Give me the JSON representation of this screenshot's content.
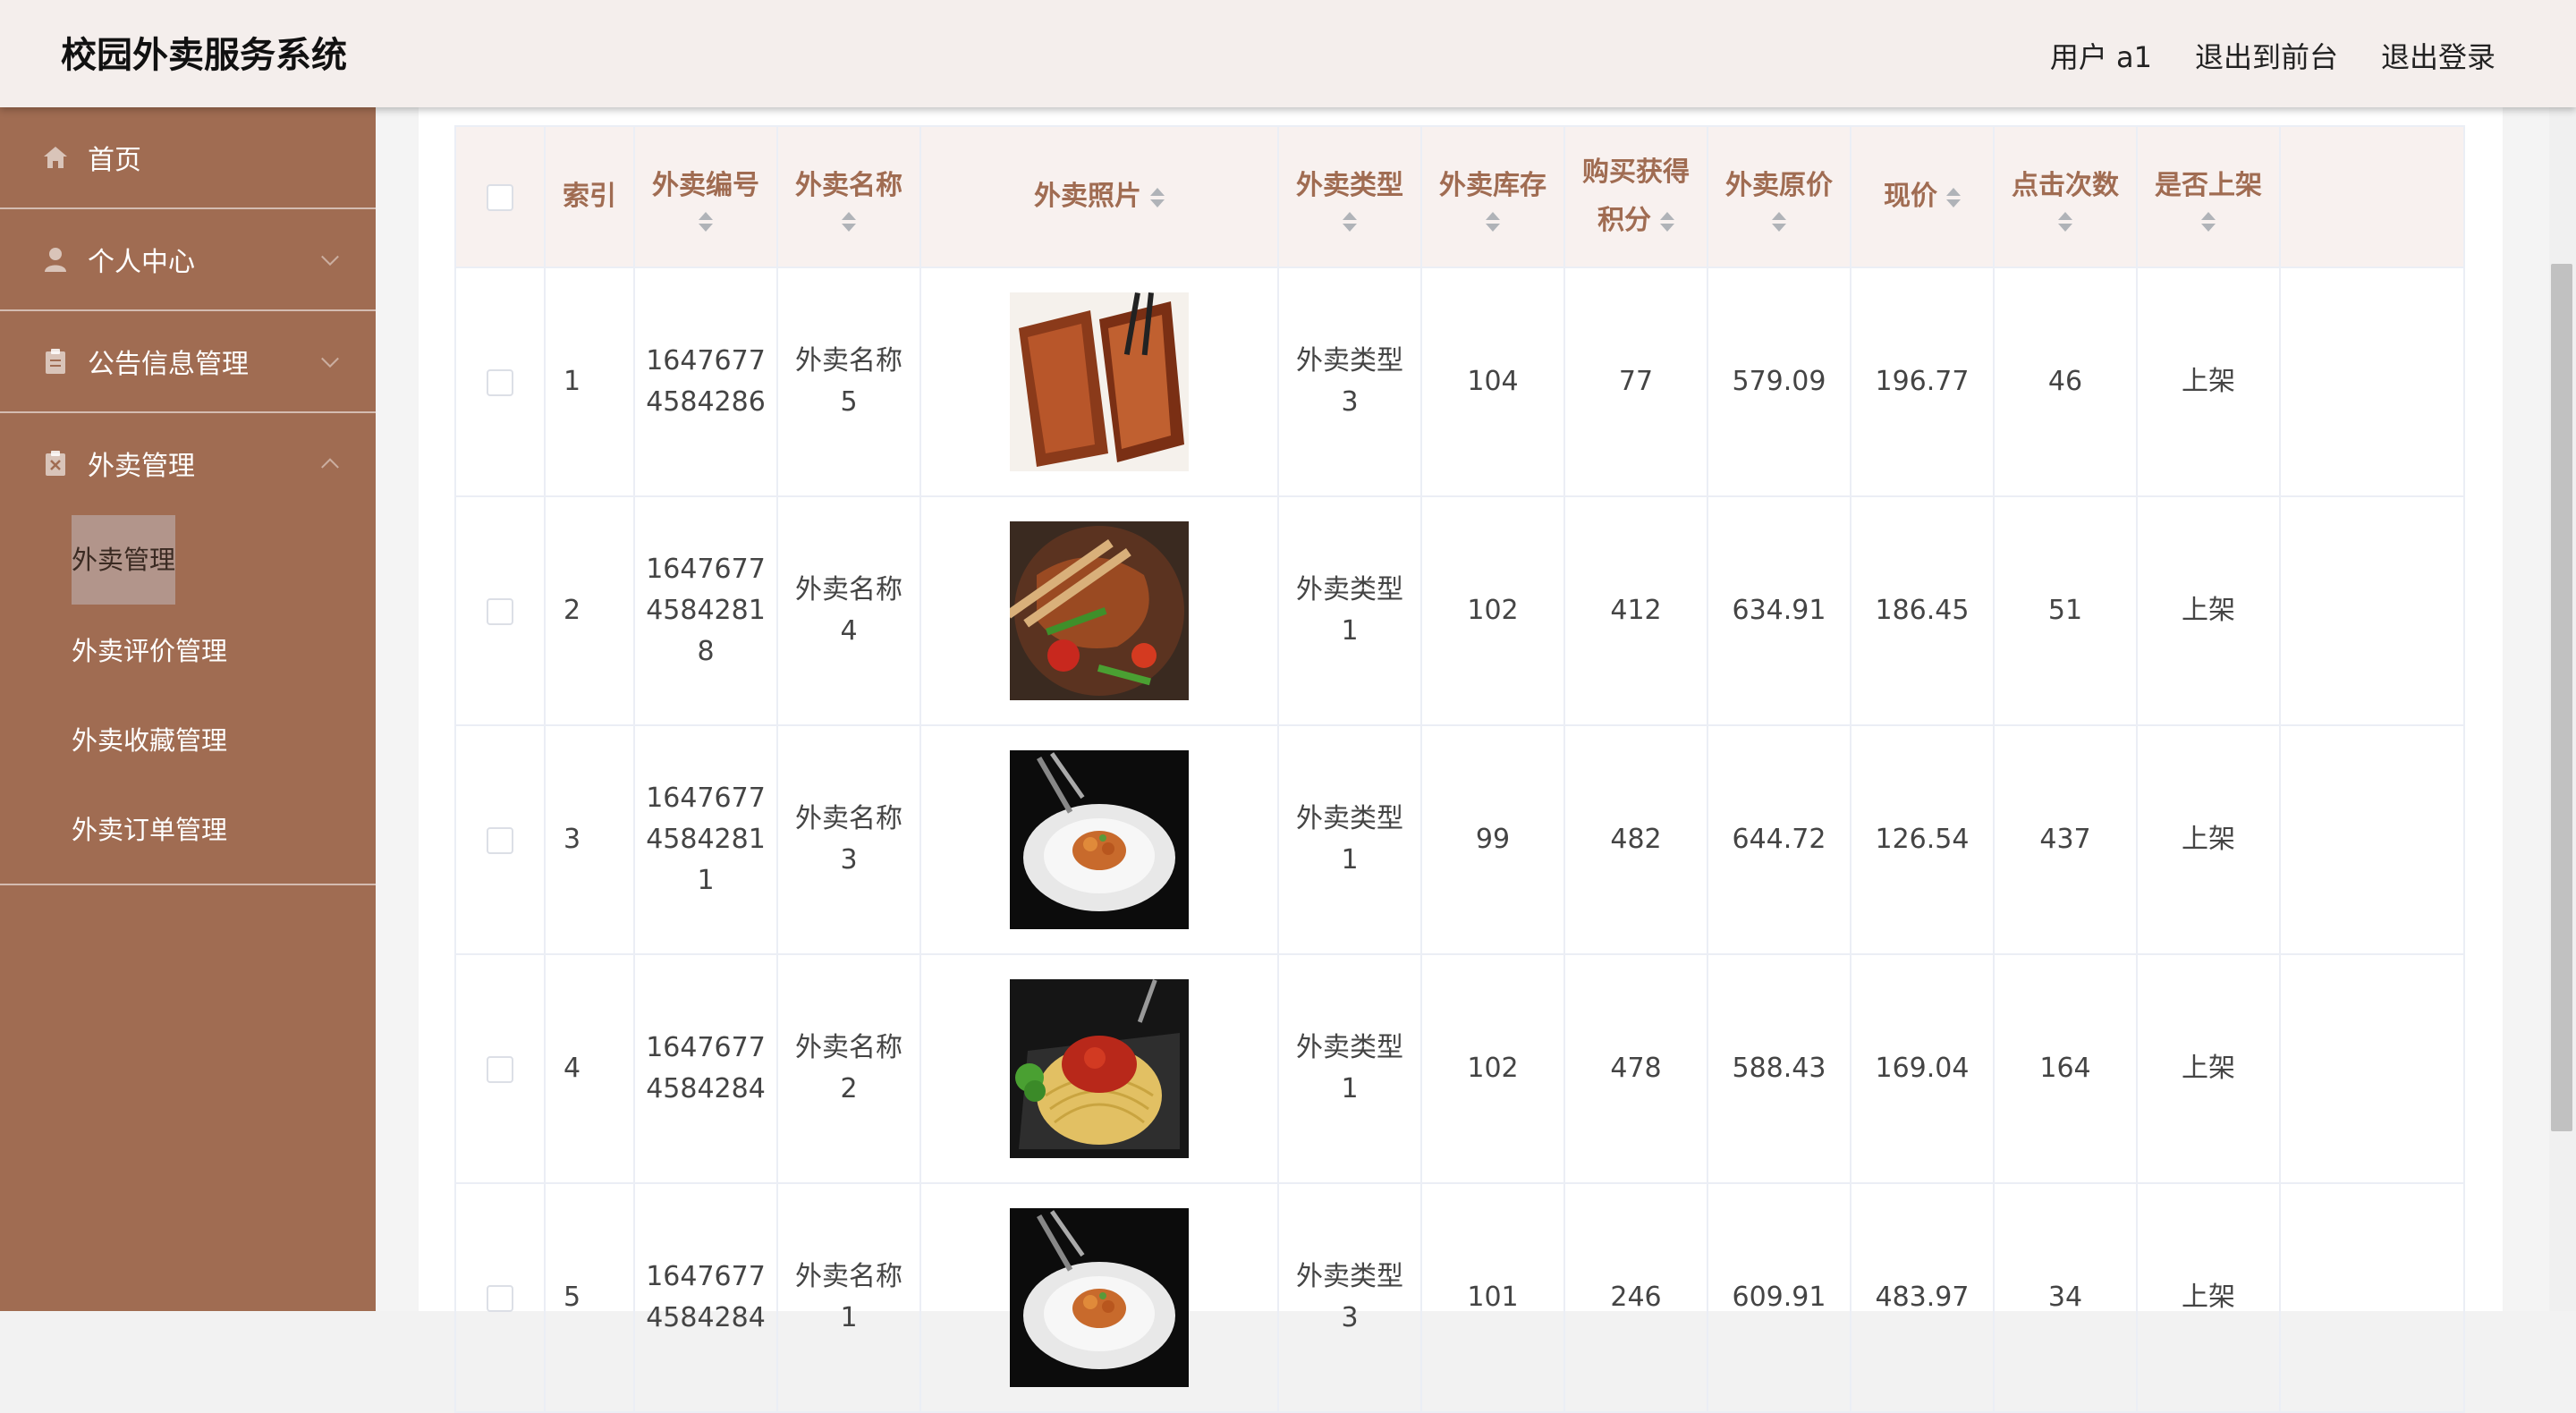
{
  "header": {
    "title": "校园外卖服务系统",
    "user_label": "用户 a1",
    "front_label": "退出到前台",
    "logout_label": "退出登录"
  },
  "sidebar": {
    "items": [
      {
        "label": "首页",
        "icon": "home-icon"
      },
      {
        "label": "个人中心",
        "icon": "user-icon"
      },
      {
        "label": "公告信息管理",
        "icon": "clipboard-icon"
      },
      {
        "label": "外卖管理",
        "icon": "clipboard-x-icon"
      }
    ],
    "submenu": [
      "外卖管理",
      "外卖评价管理",
      "外卖收藏管理",
      "外卖订单管理"
    ]
  },
  "table": {
    "headers": {
      "index": "索引",
      "code": "外卖编号",
      "name": "外卖名称",
      "photo": "外卖照片",
      "type": "外卖类型",
      "stock": "外卖库存",
      "points_a": "购买获得",
      "points_b": "积分",
      "orig": "外卖原价",
      "price": "现价",
      "clicks": "点击次数",
      "listed": "是否上架"
    },
    "rows": [
      {
        "index": "1",
        "code_a": "1647677",
        "code_b": "4584286",
        "code_c": "",
        "name_a": "外卖名称",
        "name_b": "5",
        "photo": "ribs",
        "type_a": "外卖类型",
        "type_b": "3",
        "stock": "104",
        "points": "77",
        "orig": "579.09",
        "price": "196.77",
        "clicks": "46",
        "listed": "上架"
      },
      {
        "index": "2",
        "code_a": "1647677",
        "code_b": "4584281",
        "code_c": "8",
        "name_a": "外卖名称",
        "name_b": "4",
        "photo": "stirfry",
        "type_a": "外卖类型",
        "type_b": "1",
        "stock": "102",
        "points": "412",
        "orig": "634.91",
        "price": "186.45",
        "clicks": "51",
        "listed": "上架"
      },
      {
        "index": "3",
        "code_a": "1647677",
        "code_b": "4584281",
        "code_c": "1",
        "name_a": "外卖名称",
        "name_b": "3",
        "photo": "plate",
        "type_a": "外卖类型",
        "type_b": "1",
        "stock": "99",
        "points": "482",
        "orig": "644.72",
        "price": "126.54",
        "clicks": "437",
        "listed": "上架"
      },
      {
        "index": "4",
        "code_a": "1647677",
        "code_b": "4584284",
        "code_c": "",
        "name_a": "外卖名称",
        "name_b": "2",
        "photo": "pasta",
        "type_a": "外卖类型",
        "type_b": "1",
        "stock": "102",
        "points": "478",
        "orig": "588.43",
        "price": "169.04",
        "clicks": "164",
        "listed": "上架"
      },
      {
        "index": "5",
        "code_a": "1647677",
        "code_b": "4584284",
        "code_c": "",
        "name_a": "外卖名称",
        "name_b": "1",
        "photo": "plate",
        "type_a": "外卖类型",
        "type_b": "3",
        "stock": "101",
        "points": "246",
        "orig": "609.91",
        "price": "483.97",
        "clicks": "34",
        "listed": "上架"
      }
    ]
  }
}
